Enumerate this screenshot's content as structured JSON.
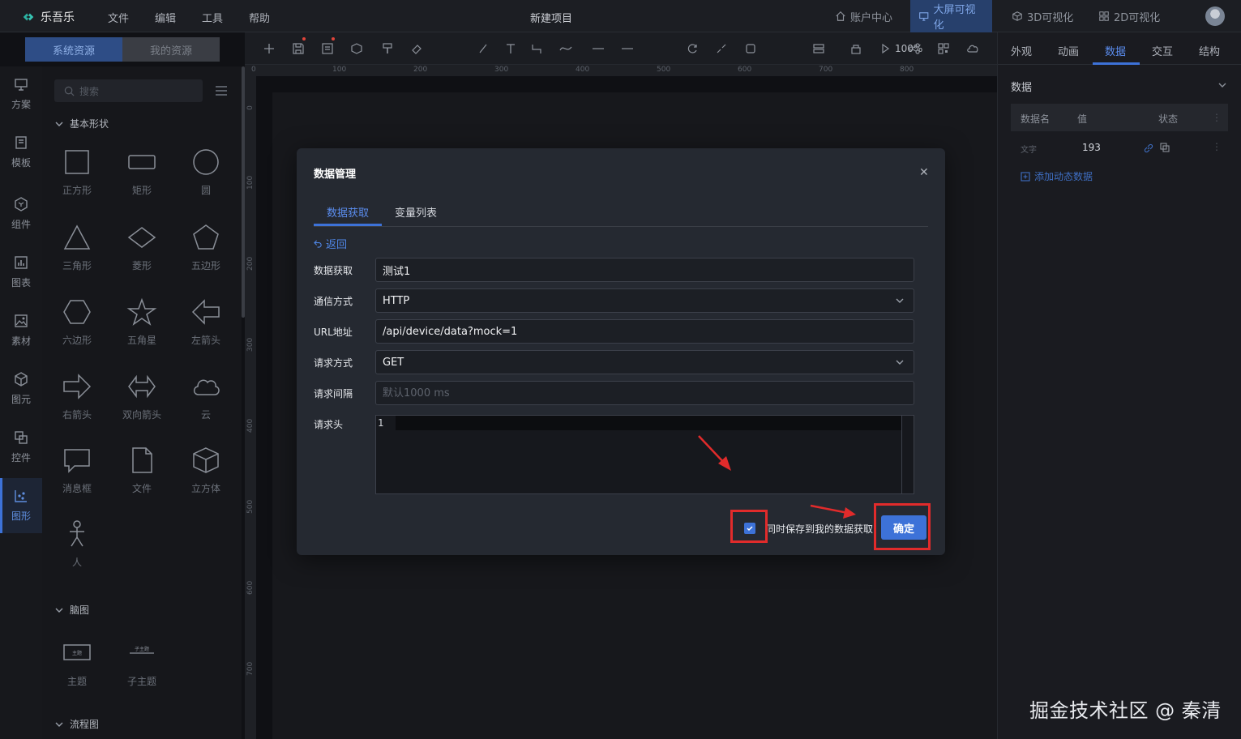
{
  "header": {
    "app_name": "乐吾乐",
    "menus": [
      "文件",
      "编辑",
      "工具",
      "帮助"
    ],
    "project_title": "新建项目",
    "nav": [
      {
        "label": "账户中心",
        "icon": "home-icon"
      },
      {
        "label": "大屏可视化",
        "icon": "monitor-icon",
        "active": true
      },
      {
        "label": "3D可视化",
        "icon": "cube-icon"
      },
      {
        "label": "2D可视化",
        "icon": "grid-icon"
      }
    ]
  },
  "resource_tabs": [
    "系统资源",
    "我的资源"
  ],
  "rail": [
    {
      "label": "方案",
      "icon": "monitor-icon"
    },
    {
      "label": "模板",
      "icon": "template-icon"
    },
    {
      "label": "组件",
      "icon": "component-icon"
    },
    {
      "label": "图表",
      "icon": "chart-icon"
    },
    {
      "label": "素材",
      "icon": "image-icon"
    },
    {
      "label": "图元",
      "icon": "cube-icon"
    },
    {
      "label": "控件",
      "icon": "controls-icon"
    },
    {
      "label": "图形",
      "icon": "shapes-icon",
      "active": true
    }
  ],
  "library": {
    "search_placeholder": "搜索",
    "sections": {
      "basic": "基本形状",
      "mindmap": "脑图",
      "flow": "流程图"
    },
    "shapes": [
      "正方形",
      "矩形",
      "圆",
      "三角形",
      "菱形",
      "五边形",
      "六边形",
      "五角星",
      "左箭头",
      "右箭头",
      "双向箭头",
      "云",
      "消息框",
      "文件",
      "立方体",
      "人"
    ],
    "mindmap_shapes": [
      "主题",
      "子主题"
    ],
    "mindmap_icon_text": [
      "主题",
      "子主题"
    ]
  },
  "toolbar": {
    "zoom": "100%"
  },
  "ruler": {
    "h": [
      "0",
      "100",
      "200",
      "300",
      "400",
      "500",
      "600",
      "700",
      "800"
    ],
    "v": [
      "0",
      "100",
      "200",
      "300",
      "400",
      "500",
      "600",
      "700"
    ]
  },
  "right_panel": {
    "tabs": [
      "外观",
      "动画",
      "数据",
      "交互",
      "结构"
    ],
    "active_tab": "数据",
    "section": "数据",
    "table_headers": [
      "数据名",
      "值",
      "状态"
    ],
    "row": {
      "name": "文字",
      "value": "193"
    },
    "add_dynamic": "添加动态数据"
  },
  "modal": {
    "title": "数据管理",
    "tabs": [
      "数据获取",
      "变量列表"
    ],
    "back": "返回",
    "fields": {
      "name_label": "数据获取",
      "name_value": "测试1",
      "protocol_label": "通信方式",
      "protocol_value": "HTTP",
      "url_label": "URL地址",
      "url_value": "/api/device/data?mock=1",
      "method_label": "请求方式",
      "method_value": "GET",
      "interval_label": "请求间隔",
      "interval_placeholder": "默认1000 ms",
      "headers_label": "请求头",
      "headers_line": "1"
    },
    "save_checkbox": {
      "label": "同时保存到我的数据获取",
      "checked": true
    },
    "confirm": "确定"
  },
  "watermark": "掘金技术社区 @ 秦清",
  "colors": {
    "accent": "#3d72d8",
    "highlight": "#e12b2b"
  }
}
